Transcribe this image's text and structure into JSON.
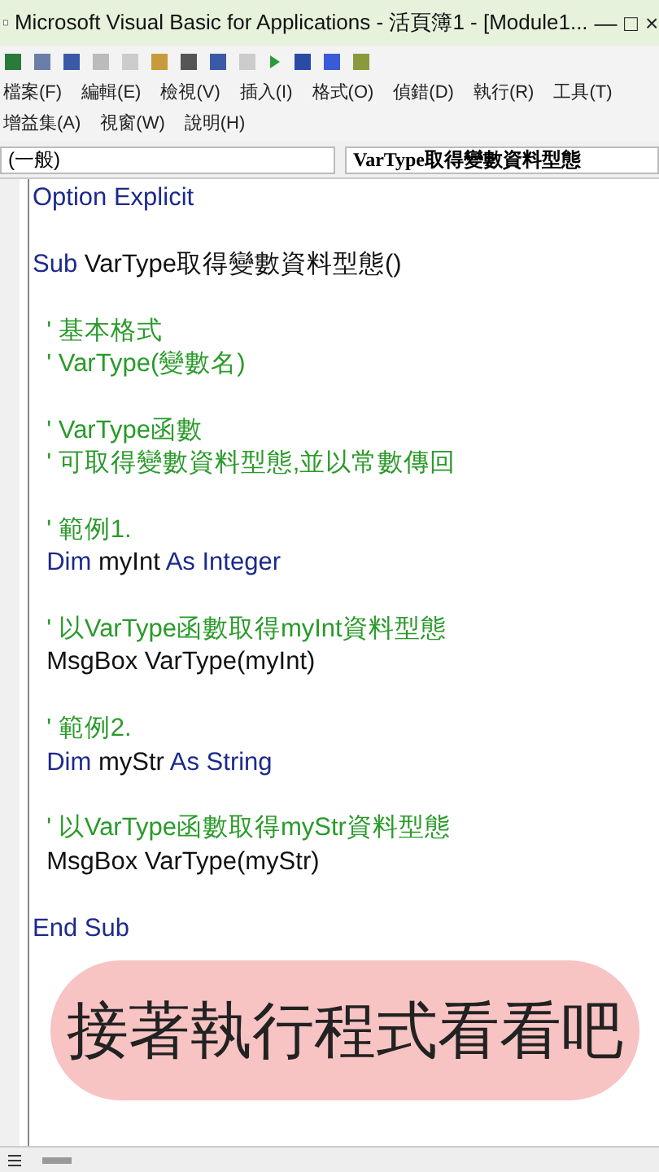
{
  "window": {
    "title": "Microsoft Visual Basic for Applications - 活頁簿1 - [Module1...",
    "controls": [
      "—",
      "□",
      "×"
    ]
  },
  "menu": [
    {
      "label": "檔案(F)"
    },
    {
      "label": "編輯(E)"
    },
    {
      "label": "檢視(V)"
    },
    {
      "label": "插入(I)"
    },
    {
      "label": "格式(O)"
    },
    {
      "label": "偵錯(D)"
    },
    {
      "label": "執行(R)"
    },
    {
      "label": "工具(T)"
    },
    {
      "label": "增益集(A)"
    },
    {
      "label": "視窗(W)"
    },
    {
      "label": "說明(H)"
    }
  ],
  "object_box": {
    "value": "(一般)"
  },
  "procedure_box": {
    "value": "VarType取得變數資料型態"
  },
  "code": [
    {
      "kind": "code",
      "parts": [
        {
          "text": "Option Explicit",
          "kind": "keyword"
        }
      ]
    },
    {
      "kind": "blank"
    },
    {
      "kind": "code",
      "parts": [
        {
          "text": "Sub",
          "kind": "keyword"
        },
        {
          "text": " VarType取得變數資料型態()",
          "kind": "plain"
        }
      ]
    },
    {
      "kind": "blank"
    },
    {
      "kind": "code",
      "parts": [
        {
          "text": "  ' 基本格式",
          "kind": "comment"
        }
      ]
    },
    {
      "kind": "code",
      "parts": [
        {
          "text": "  ' VarType(變數名)",
          "kind": "comment"
        }
      ]
    },
    {
      "kind": "blank"
    },
    {
      "kind": "code",
      "parts": [
        {
          "text": "  ' VarType函數",
          "kind": "comment"
        }
      ]
    },
    {
      "kind": "code",
      "parts": [
        {
          "text": "  ' 可取得變數資料型態,並以常數傳回",
          "kind": "comment"
        }
      ]
    },
    {
      "kind": "blank"
    },
    {
      "kind": "code",
      "parts": [
        {
          "text": "  ' 範例1.",
          "kind": "comment"
        }
      ]
    },
    {
      "kind": "code",
      "parts": [
        {
          "text": "  Dim",
          "kind": "keyword"
        },
        {
          "text": " myInt ",
          "kind": "plain"
        },
        {
          "text": "As Integer",
          "kind": "keyword"
        }
      ]
    },
    {
      "kind": "blank"
    },
    {
      "kind": "code",
      "parts": [
        {
          "text": "  ' 以VarType函數取得myInt資料型態",
          "kind": "comment"
        }
      ]
    },
    {
      "kind": "code",
      "parts": [
        {
          "text": "  MsgBox VarType(myInt)",
          "kind": "plain"
        }
      ]
    },
    {
      "kind": "blank"
    },
    {
      "kind": "code",
      "parts": [
        {
          "text": "  ' 範例2.",
          "kind": "comment"
        }
      ]
    },
    {
      "kind": "code",
      "parts": [
        {
          "text": "  Dim",
          "kind": "keyword"
        },
        {
          "text": " myStr ",
          "kind": "plain"
        },
        {
          "text": "As String",
          "kind": "keyword"
        }
      ]
    },
    {
      "kind": "blank"
    },
    {
      "kind": "code",
      "parts": [
        {
          "text": "  ' 以VarType函數取得myStr資料型態",
          "kind": "comment"
        }
      ]
    },
    {
      "kind": "code",
      "parts": [
        {
          "text": "  MsgBox VarType(myStr)",
          "kind": "plain"
        }
      ]
    },
    {
      "kind": "blank"
    },
    {
      "kind": "code",
      "parts": [
        {
          "text": "End Sub",
          "kind": "keyword"
        }
      ]
    }
  ],
  "caption": "接著執行程式看看吧"
}
